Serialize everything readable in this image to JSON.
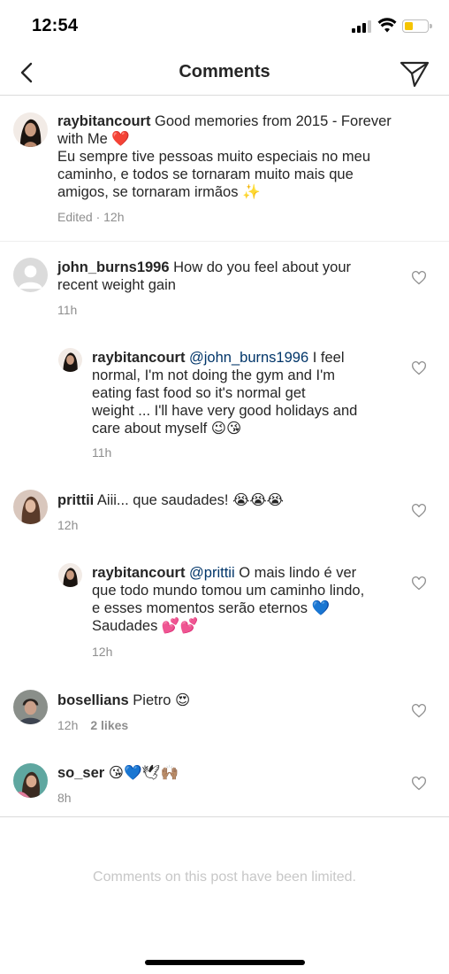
{
  "status_bar": {
    "time": "12:54"
  },
  "header": {
    "title": "Comments"
  },
  "caption": {
    "username": "raybitancourt",
    "text_line1": " Good memories from 2015 - Forever",
    "text_line2": "with Me ❤️",
    "text_line3": "Eu sempre tive pessoas muito especiais no meu",
    "text_line4": "caminho, e todos se tornaram muito mais que",
    "text_line5": "amigos, se tornaram irmãos ✨",
    "meta": "Edited · 12h"
  },
  "comments": [
    {
      "username": "john_burns1996",
      "text_line1": " How do you feel about your",
      "text_line2": "recent weight gain",
      "time": "11h"
    },
    {
      "username": "raybitancourt",
      "mention": " @john_burns1996",
      "text_line1": " I feel",
      "text_line2": "normal, I'm not doing the gym and I'm",
      "text_line3": "eating fast food so it's normal get",
      "text_line4": "weight ... I'll have very good holidays and",
      "text_line5": "care about myself 😉😘",
      "time": "11h"
    },
    {
      "username": "prittii",
      "text_line1": " Aiii... que saudades! 😭😭😭",
      "time": "12h"
    },
    {
      "username": "raybitancourt",
      "mention": " @prittii",
      "text_line1": " O mais lindo é ver",
      "text_line2": "que todo mundo tomou um caminho lindo,",
      "text_line3": "e esses momentos serão eternos 💙",
      "text_line4": "Saudades 💕💕",
      "time": "12h"
    },
    {
      "username": "bosellians",
      "text_line1": " Pietro 😍",
      "time": "12h",
      "likes": "2 likes"
    },
    {
      "username": "so_ser",
      "text_line1": " 😘💙🕊🙌🏽",
      "time": "8h"
    }
  ],
  "footer": {
    "note": "Comments on this post have been limited."
  }
}
